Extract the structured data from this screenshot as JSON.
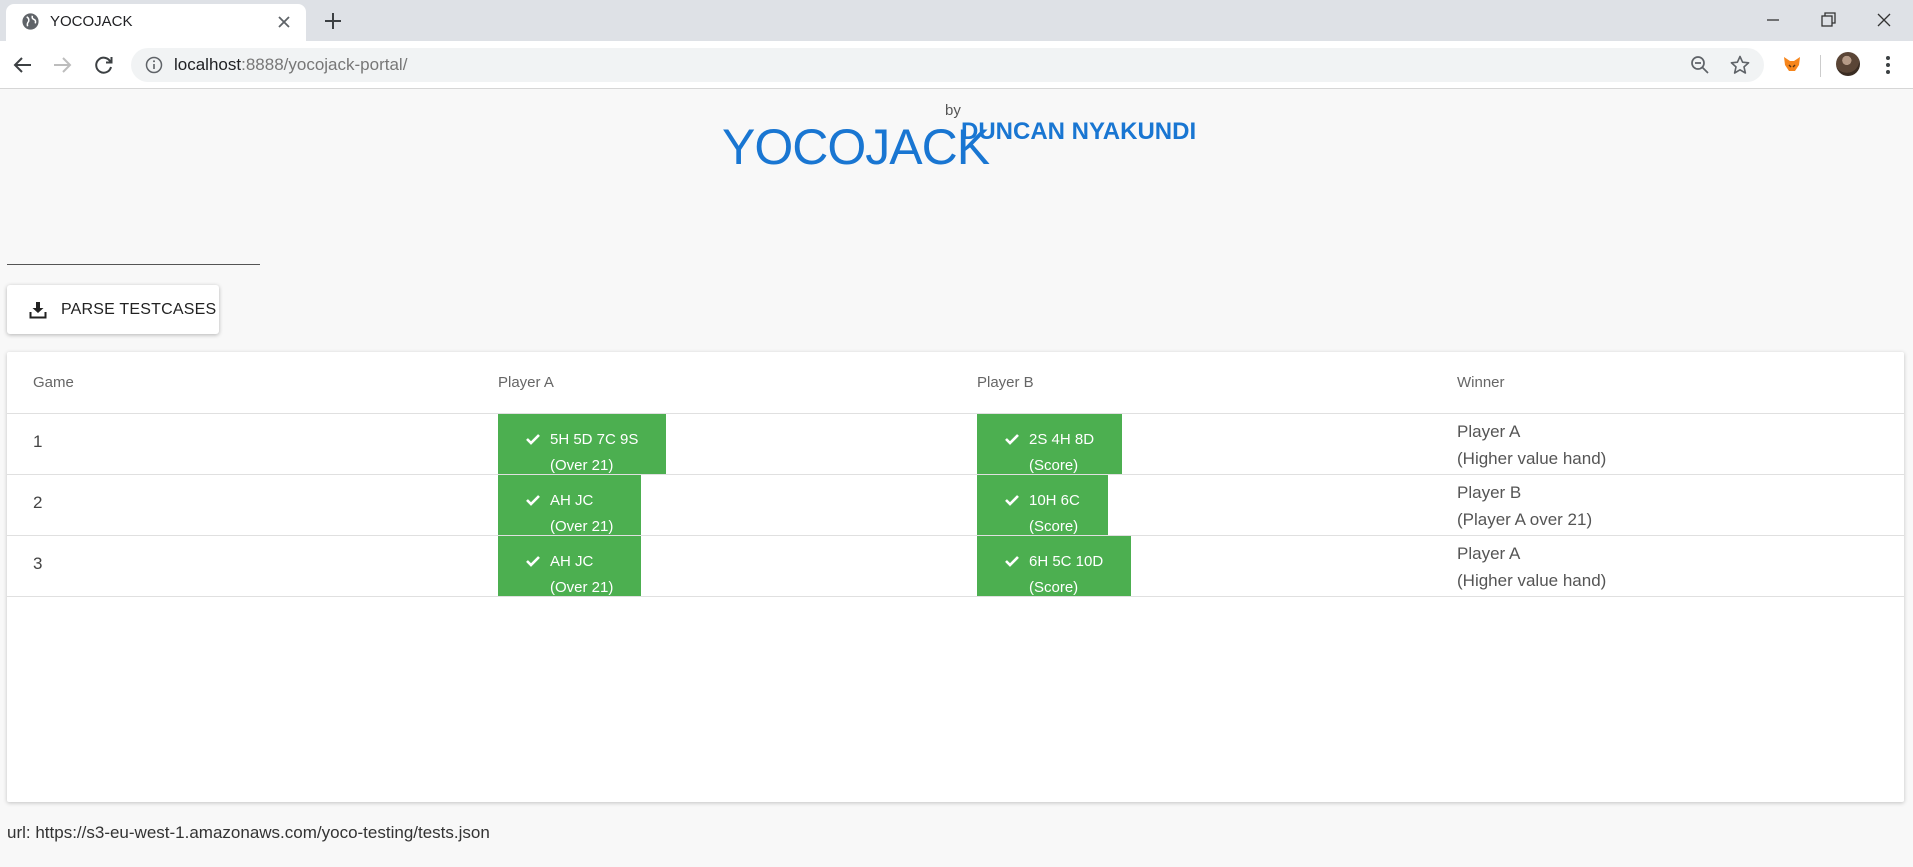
{
  "browser": {
    "tab_title": "YOCOJACK",
    "url_host": "localhost",
    "url_rest": ":8888/yocojack-portal/"
  },
  "header": {
    "title": "YOCOJACK",
    "by": "by",
    "author": "DUNCAN NYAKUNDI"
  },
  "toolbar": {
    "parse_label": "PARSE TESTCASES"
  },
  "table": {
    "columns": [
      "Game",
      "Player A",
      "Player B",
      "Winner"
    ],
    "rows": [
      {
        "game": "1",
        "player_a": {
          "cards": "5H 5D 7C 9S",
          "status": "(Over 21)"
        },
        "player_b": {
          "cards": "2S 4H 8D",
          "status": "(Score)"
        },
        "winner": {
          "name": "Player A",
          "reason": "(Higher value hand)"
        }
      },
      {
        "game": "2",
        "player_a": {
          "cards": "AH JC",
          "status": "(Over 21)"
        },
        "player_b": {
          "cards": "10H 6C",
          "status": "(Score)"
        },
        "winner": {
          "name": "Player B",
          "reason": "(Player A over 21)"
        }
      },
      {
        "game": "3",
        "player_a": {
          "cards": "AH JC",
          "status": "(Over 21)"
        },
        "player_b": {
          "cards": "6H 5C 10D",
          "status": "(Score)"
        },
        "winner": {
          "name": "Player A",
          "reason": "(Higher value hand)"
        }
      }
    ]
  },
  "footer": {
    "url_text": "url: https://s3-eu-west-1.amazonaws.com/yoco-testing/tests.json"
  },
  "colors": {
    "accent_blue": "#1976d2",
    "chip_green": "#4caf50"
  }
}
